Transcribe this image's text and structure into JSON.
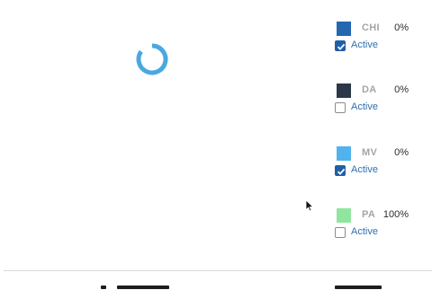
{
  "loading_indicator": {
    "icon": "spinner-icon",
    "color": "#4aa8e0"
  },
  "legend": {
    "items": [
      {
        "code": "CHI",
        "percent": "0%",
        "swatch_color": "#2267b0",
        "active_label": "Active",
        "active_checked": true
      },
      {
        "code": "DA",
        "percent": "0%",
        "swatch_color": "#2c3747",
        "active_label": "Active",
        "active_checked": false
      },
      {
        "code": "MV",
        "percent": "0%",
        "swatch_color": "#52b3ec",
        "active_label": "Active",
        "active_checked": true
      },
      {
        "code": "PA",
        "percent": "100%",
        "swatch_color": "#8ee69f",
        "active_label": "Active",
        "active_checked": false
      }
    ]
  },
  "colors": {
    "checkbox_checked": "#1f5fa6",
    "active_text": "#2f6fad",
    "code_text": "#a5a5a5"
  }
}
